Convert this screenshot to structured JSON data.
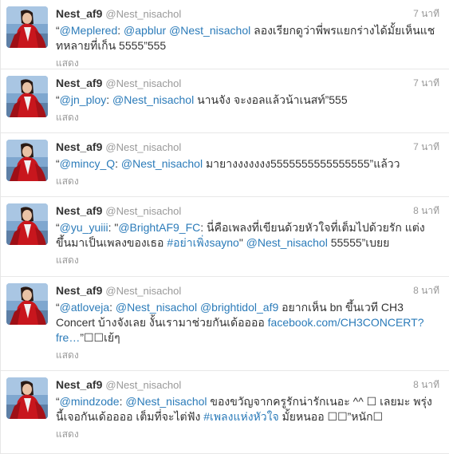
{
  "colors": {
    "link": "#2b7bb9",
    "name": "#333333",
    "muted": "#999999"
  },
  "avatar_icon": "profile-photo-red-dress",
  "tweets": [
    {
      "name": "Nest_af9",
      "handle": "@Nest_nisachol",
      "time": "7 นาที",
      "segments": [
        {
          "t": "“",
          "link": false
        },
        {
          "t": "@Meplered",
          "link": true
        },
        {
          "t": ": ",
          "link": false
        },
        {
          "t": "@apblur",
          "link": true
        },
        {
          "t": " ",
          "link": false
        },
        {
          "t": "@Nest_nisachol",
          "link": true
        },
        {
          "t": " ลองเรียกดูว่าพี่พรแยกร่างได้มั้ยเห็นแชทหลายที่เก็น 5555”555",
          "link": false
        }
      ],
      "expand": "แสดง",
      "height": 87
    },
    {
      "name": "Nest_af9",
      "handle": "@Nest_nisachol",
      "time": "7 นาที",
      "segments": [
        {
          "t": "“",
          "link": false
        },
        {
          "t": "@jn_ploy",
          "link": true
        },
        {
          "t": ": ",
          "link": false
        },
        {
          "t": "@Nest_nisachol",
          "link": true
        },
        {
          "t": " นานจัง จะงอลแล้วน้าเนสท์”555",
          "link": false
        }
      ],
      "expand": "แสดง",
      "height": 80
    },
    {
      "name": "Nest_af9",
      "handle": "@Nest_nisachol",
      "time": "7 นาที",
      "segments": [
        {
          "t": "“",
          "link": false
        },
        {
          "t": "@mincy_Q",
          "link": true
        },
        {
          "t": ": ",
          "link": false
        },
        {
          "t": "@Nest_nisachol",
          "link": true
        },
        {
          "t": " มายางงงงงงง5555555555555555”แล้วว",
          "link": false
        }
      ],
      "expand": "แสดง",
      "height": 80
    },
    {
      "name": "Nest_af9",
      "handle": "@Nest_nisachol",
      "time": "8 นาที",
      "segments": [
        {
          "t": "“",
          "link": false
        },
        {
          "t": "@yu_yuiii",
          "link": true
        },
        {
          "t": ": \"",
          "link": false
        },
        {
          "t": "@BrightAF9_FC",
          "link": true
        },
        {
          "t": ": นี่คือเพลงที่เขียนด้วยหัวใจที่เต็มไปด้วยรัก แต่งขึ้นมาเป็นเพลงของเธอ ",
          "link": false
        },
        {
          "t": "#อย่าเพิ่งsayno",
          "link": true
        },
        {
          "t": "\" ",
          "link": false
        },
        {
          "t": "@Nest_nisachol",
          "link": true
        },
        {
          "t": " 55555”เบยย",
          "link": false
        }
      ],
      "expand": "แสดง",
      "height": 100
    },
    {
      "name": "Nest_af9",
      "handle": "@Nest_nisachol",
      "time": "8 นาที",
      "segments": [
        {
          "t": "“",
          "link": false
        },
        {
          "t": "@atloveja",
          "link": true
        },
        {
          "t": ": ",
          "link": false
        },
        {
          "t": "@Nest_nisachol",
          "link": true
        },
        {
          "t": " ",
          "link": false
        },
        {
          "t": "@brightidol_af9",
          "link": true
        },
        {
          "t": " อยากเห็น bn ขึ้นเวที CH3 Concert บ้างจังเลย งั้นเรามาช่วยกันเด้ออออ ",
          "link": false
        },
        {
          "t": "facebook.com/CH3CONCERT?fre…",
          "link": true
        },
        {
          "t": "”☐☐เย้ๆ",
          "link": false
        }
      ],
      "expand": "แสดง",
      "height": 118
    },
    {
      "name": "Nest_af9",
      "handle": "@Nest_nisachol",
      "time": "8 นาที",
      "segments": [
        {
          "t": "“",
          "link": false
        },
        {
          "t": "@mindzode",
          "link": true
        },
        {
          "t": ": ",
          "link": false
        },
        {
          "t": "@Nest_nisachol",
          "link": true
        },
        {
          "t": " ของขวัญจากครูรักน่ารักเนอะ ^^ ☐ เลยมะ พรุ่งนี้เจอกันเด้ออออ เต็มที่จะไต่ฟัง ",
          "link": false
        },
        {
          "t": "#เพลงแห่งหัวใจ",
          "link": true
        },
        {
          "t": " มั้ยหนออ ☐☐”หนัก☐",
          "link": false
        }
      ],
      "expand": "แสดง",
      "height": 104
    }
  ]
}
